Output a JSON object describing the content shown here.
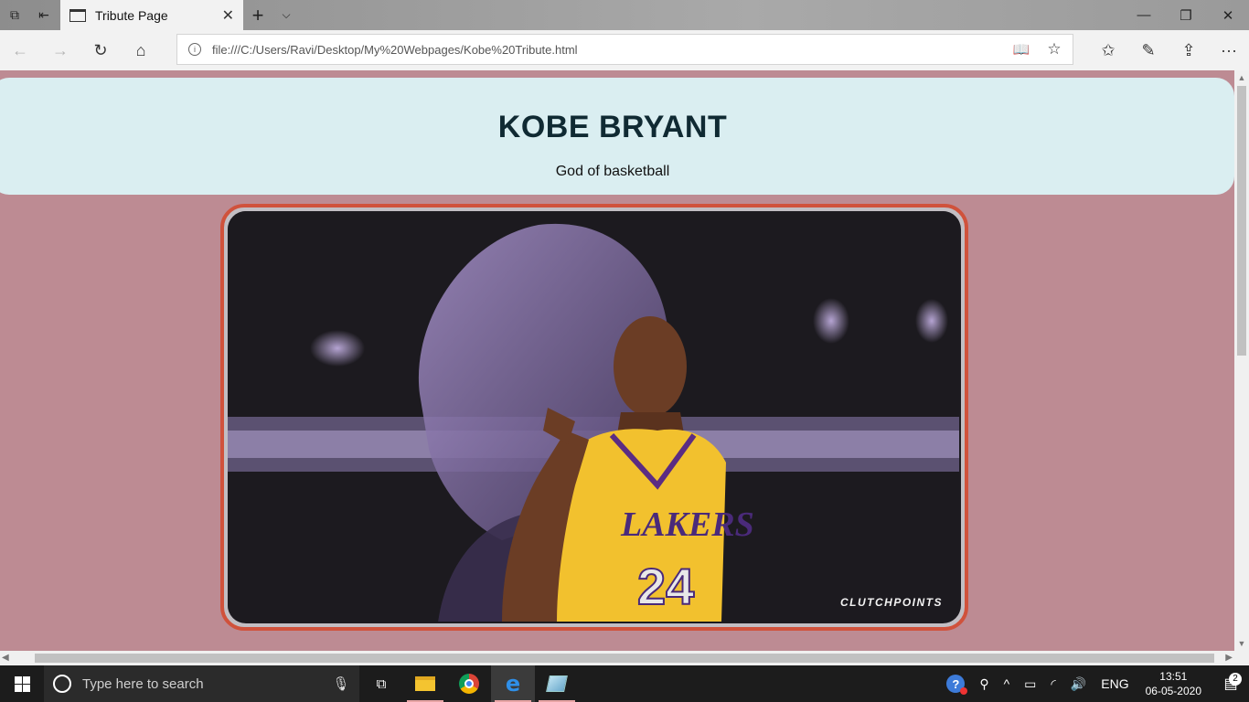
{
  "browser": {
    "tab_title": "Tribute Page",
    "url": "file:///C:/Users/Ravi/Desktop/My%20Webpages/Kobe%20Tribute.html"
  },
  "page": {
    "heading": "KOBE BRYANT",
    "subheading": "God of basketball",
    "image_watermark": "CLUTCHPOINTS",
    "colors": {
      "background": "#bd8b93",
      "header_bg": "#daeef1",
      "frame_border": "#d0523c"
    }
  },
  "taskbar": {
    "search_placeholder": "Type here to search",
    "language": "ENG",
    "time": "13:51",
    "date": "06-05-2020",
    "notification_count": "2"
  }
}
